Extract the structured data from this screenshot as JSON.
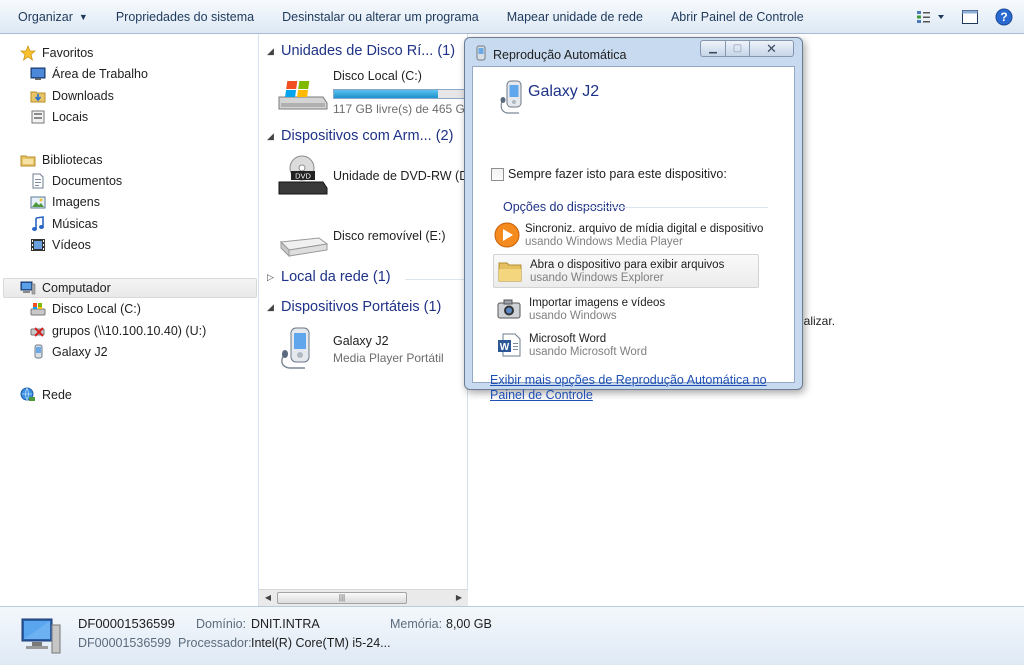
{
  "toolbar": {
    "organize": "Organizar",
    "system_properties": "Propriedades do sistema",
    "uninstall": "Desinstalar ou alterar um programa",
    "map_drive": "Mapear unidade de rede",
    "control_panel": "Abrir Painel de Controle"
  },
  "nav": {
    "favorites": "Favoritos",
    "desktop": "Área de Trabalho",
    "downloads": "Downloads",
    "places": "Locais",
    "libraries": "Bibliotecas",
    "documents": "Documentos",
    "images": "Imagens",
    "music": "Músicas",
    "videos": "Vídeos",
    "computer": "Computador",
    "local_disk": "Disco Local (C:)",
    "network_share": "grupos (\\\\10.100.10.40) (U:)",
    "galaxy": "Galaxy J2",
    "network": "Rede"
  },
  "content": {
    "hdd_group": "Unidades de Disco Rí... (1)",
    "local_disk_name": "Disco Local (C:)",
    "local_disk_free": "117 GB livre(s) de 465 GB",
    "local_disk_fill": 0.75,
    "removable_group": "Dispositivos com Arm... (2)",
    "dvd_name": "Unidade de DVD-RW (D:)",
    "dvd_label": "DVD",
    "removable_name": "Disco removível (E:)",
    "network_group": "Local da rede (1)",
    "portable_group": "Dispositivos Portáteis (1)",
    "galaxy_name": "Galaxy J2",
    "galaxy_type": "Media Player Portátil",
    "trailing_text": "ualizar."
  },
  "dialog": {
    "title": "Reprodução Automática",
    "device": "Galaxy J2",
    "always_do": "Sempre fazer isto para este dispositivo:",
    "options_header": "Opções do dispositivo",
    "options": [
      {
        "title": "Sincroniz. arquivo de mídia digital e dispositivo",
        "sub": "usando Windows Media Player",
        "icon": "media-player-icon"
      },
      {
        "title": "Abra o dispositivo para exibir arquivos",
        "sub": "usando Windows Explorer",
        "icon": "folder-icon"
      },
      {
        "title": "Importar imagens e vídeos",
        "sub": "usando Windows",
        "icon": "camera-icon"
      },
      {
        "title": "Microsoft Word",
        "sub": "usando Microsoft Word",
        "icon": "word-icon"
      }
    ],
    "more_link": "Exibir mais opções de Reprodução Automática no Painel de Controle"
  },
  "status": {
    "computer_name": "DF00001536599",
    "domain_label": "Domínio:",
    "domain_value": "DNIT.INTRA",
    "memory_label": "Memória:",
    "memory_value": "8,00 GB",
    "computer_name2": "DF00001536599",
    "processor_label": "Processador:",
    "processor_value": "Intel(R) Core(TM) i5-24..."
  },
  "colors": {
    "header_blue": "#1e3287",
    "link_blue": "#1e4fb3",
    "disk_bar": "#26a0da"
  }
}
